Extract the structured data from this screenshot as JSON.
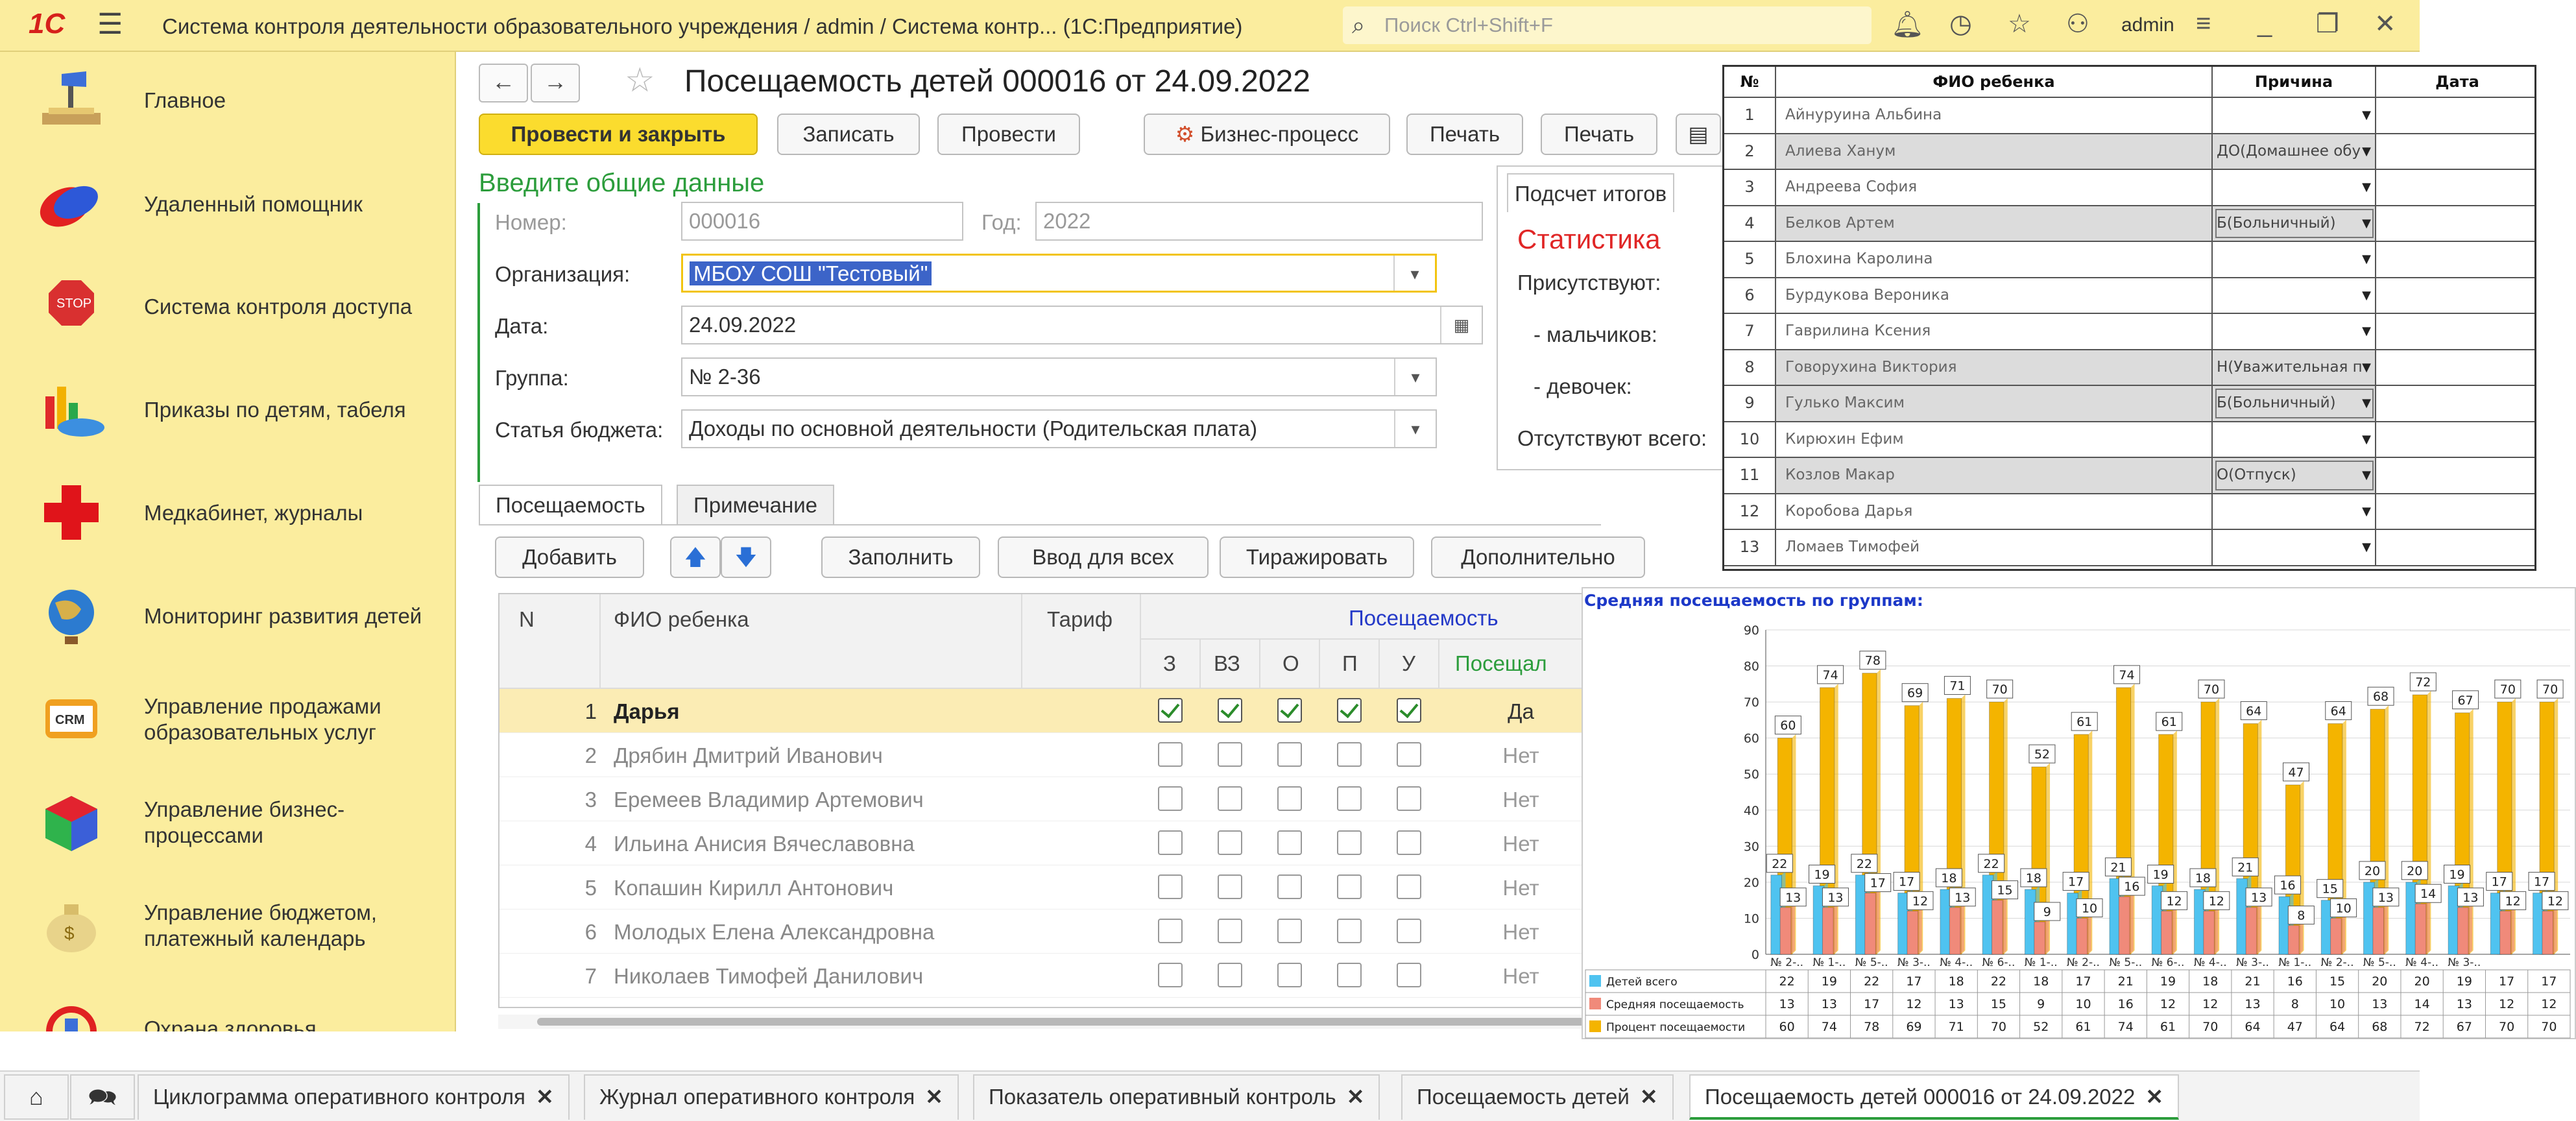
{
  "app": {
    "logo": "1С",
    "title": "Система контроля деятельности образовательного учреждения / admin / Система контр...  (1С:Предприятие)",
    "search_placeholder": "Поиск Ctrl+Shift+F",
    "user": "admin"
  },
  "sidebar": {
    "items": [
      {
        "label": "Главное",
        "icon": "desk-lamp-icon"
      },
      {
        "label": "Удаленный помощник",
        "icon": "remote-helper-icon"
      },
      {
        "label": "Система контроля доступа",
        "icon": "stop-hand-icon"
      },
      {
        "label": "Приказы по детям, табеля",
        "icon": "charts-icon"
      },
      {
        "label": "Медкабинет, журналы",
        "icon": "red-cross-icon"
      },
      {
        "label": "Мониторинг развития детей",
        "icon": "globe-icon"
      },
      {
        "label": "Управление продажами образовательных услуг",
        "icon": "crm-icon"
      },
      {
        "label": "Управление бизнес-процессами",
        "icon": "cubes-icon"
      },
      {
        "label": "Управление бюджетом, платежный календарь",
        "icon": "money-bag-icon"
      },
      {
        "label": "Охрана здоровья",
        "icon": "health-icon"
      }
    ]
  },
  "doc": {
    "title": "Посещаемость детей 000016 от 24.09.2022",
    "buttons": {
      "post_close": "Провести и закрыть",
      "save": "Записать",
      "post": "Провести",
      "bp": "Бизнес-процесс",
      "print1": "Печать",
      "print2": "Печать"
    },
    "section_title": "Введите общие данные",
    "fields": {
      "number_label": "Номер:",
      "number_value": "000016",
      "year_label": "Год:",
      "year_value": "2022",
      "org_label": "Организация:",
      "org_value": "МБОУ СОШ \"Тестовый\"",
      "date_label": "Дата:",
      "date_value": "24.09.2022",
      "group_label": "Группа:",
      "group_value": "№ 2-36",
      "budget_label": "Статья бюджета:",
      "budget_value": "Доходы по основной деятельности (Родительская плата)"
    },
    "stats": {
      "tab": "Подсчет итогов",
      "title": "Статистика",
      "present": "Присутствуют:",
      "boys": "-  мальчиков:",
      "girls": "-  девочек:",
      "absent": "Отсутствуют всего:"
    },
    "tabs": [
      "Посещаемость",
      "Примечание"
    ],
    "toolbar": {
      "add": "Добавить",
      "fill": "Заполнить",
      "enter_all": "Ввод для всех",
      "replicate": "Тиражировать",
      "more": "Дополнительно"
    },
    "grid": {
      "headers": {
        "n": "N",
        "fio": "ФИО ребенка",
        "tarif": "Тариф",
        "attendance": "Посещаемость",
        "z": "З",
        "vz": "ВЗ",
        "o": "О",
        "p": "П",
        "u": "У",
        "visited": "Посещал"
      },
      "rows": [
        {
          "n": "1",
          "fio": "Дарья",
          "checks": [
            true,
            true,
            true,
            true,
            true
          ],
          "visited": "Да",
          "selected": true
        },
        {
          "n": "2",
          "fio": "Дрябин Дмитрий Иванович",
          "checks": [
            false,
            false,
            false,
            false,
            false
          ],
          "visited": "Нет"
        },
        {
          "n": "3",
          "fio": "Еремеев Владимир Артемович",
          "checks": [
            false,
            false,
            false,
            false,
            false
          ],
          "visited": "Нет"
        },
        {
          "n": "4",
          "fio": "Ильина Анисия Вячеславовна",
          "checks": [
            false,
            false,
            false,
            false,
            false
          ],
          "visited": "Нет"
        },
        {
          "n": "5",
          "fio": "Копашин Кирилл Антонович",
          "checks": [
            false,
            false,
            false,
            false,
            false
          ],
          "visited": "Нет"
        },
        {
          "n": "6",
          "fio": "Молодых Елена Александровна",
          "checks": [
            false,
            false,
            false,
            false,
            false
          ],
          "visited": "Нет"
        },
        {
          "n": "7",
          "fio": "Николаев Тимофей Данилович",
          "checks": [
            false,
            false,
            false,
            false,
            false
          ],
          "visited": "Нет"
        }
      ]
    }
  },
  "form_table": {
    "headers": {
      "n": "№",
      "fio": "ФИО ребенка",
      "reason": "Причина",
      "date": "Дата"
    },
    "rows": [
      {
        "n": "1",
        "fio": "Айнуруина Альбина",
        "reason": "",
        "shade": false,
        "boxed": false
      },
      {
        "n": "2",
        "fio": "Алиева Ханум",
        "reason": "ДО(Домашнее обу",
        "shade": true,
        "boxed": false
      },
      {
        "n": "3",
        "fio": "Андреева София",
        "reason": "",
        "shade": false,
        "boxed": false
      },
      {
        "n": "4",
        "fio": "Белков Артем",
        "reason": "Б(Больничный)",
        "shade": true,
        "boxed": true
      },
      {
        "n": "5",
        "fio": "Блохина Каролина",
        "reason": "",
        "shade": false,
        "boxed": false
      },
      {
        "n": "6",
        "fio": "Бурдукова Вероника",
        "reason": "",
        "shade": false,
        "boxed": false
      },
      {
        "n": "7",
        "fio": "Гаврилина Ксения",
        "reason": "",
        "shade": false,
        "boxed": false
      },
      {
        "n": "8",
        "fio": "Говорухина Виктория",
        "reason": "Н(Уважительная п",
        "shade": true,
        "boxed": false
      },
      {
        "n": "9",
        "fio": "Гулько Максим",
        "reason": "Б(Больничный)",
        "shade": true,
        "boxed": true
      },
      {
        "n": "10",
        "fio": "Кирюхин Ефим",
        "reason": "",
        "shade": false,
        "boxed": false
      },
      {
        "n": "11",
        "fio": "Козлов Макар",
        "reason": "О(Отпуск)",
        "shade": true,
        "boxed": true
      },
      {
        "n": "12",
        "fio": "Коробова Дарья",
        "reason": "",
        "shade": false,
        "boxed": false
      },
      {
        "n": "13",
        "fio": "Ломаев Тимофей",
        "reason": "",
        "shade": false,
        "boxed": false
      }
    ]
  },
  "chart_data": {
    "type": "bar",
    "title": "Средняя посещаемость по группам:",
    "categories": [
      "№ 2-..",
      "№ 1-..",
      "№ 5-..",
      "№ 3-..",
      "№ 4-..",
      "№ 6-..",
      "№ 1-..",
      "№ 2-..",
      "№ 5-..",
      "№ 6-..",
      "№ 4-..",
      "№ 3-..",
      "№ 1-..",
      "№ 2-..",
      "№ 5-..",
      "№ 4-..",
      "№ 3-..",
      "",
      ""
    ],
    "ylim": [
      0,
      90
    ],
    "yticks": [
      0,
      10,
      20,
      30,
      40,
      50,
      60,
      70,
      80,
      90
    ],
    "grid": true,
    "legend_position": "bottom-left-table",
    "series": [
      {
        "name": "Детей всего",
        "color": "#4fc3f0",
        "values": [
          22,
          19,
          22,
          17,
          18,
          22,
          18,
          17,
          21,
          19,
          18,
          21,
          16,
          15,
          20,
          20,
          19,
          17,
          17
        ]
      },
      {
        "name": "Средняя посещаемость",
        "color": "#f08a7a",
        "values": [
          13,
          13,
          17,
          12,
          13,
          15,
          9,
          10,
          16,
          12,
          12,
          13,
          8,
          10,
          13,
          14,
          13,
          12,
          12
        ]
      },
      {
        "name": "Процент посещаемости",
        "color": "#f4b400",
        "values": [
          60,
          74,
          78,
          69,
          71,
          70,
          52,
          61,
          74,
          61,
          70,
          64,
          47,
          64,
          68,
          72,
          67,
          70,
          70
        ]
      }
    ]
  },
  "window_tabs": [
    {
      "label": "Циклограмма оперативного контроля"
    },
    {
      "label": "Журнал оперативного контроля"
    },
    {
      "label": "Показатель оперативный контроль"
    },
    {
      "label": "Посещаемость детей"
    },
    {
      "label": "Посещаемость детей 000016 от 24.09.2022",
      "active": true
    }
  ],
  "colors": {
    "accent_yellow": "#fbdc2e",
    "panel_yellow": "#fbed9e",
    "green": "#2c9d3c",
    "red": "#e02626"
  }
}
